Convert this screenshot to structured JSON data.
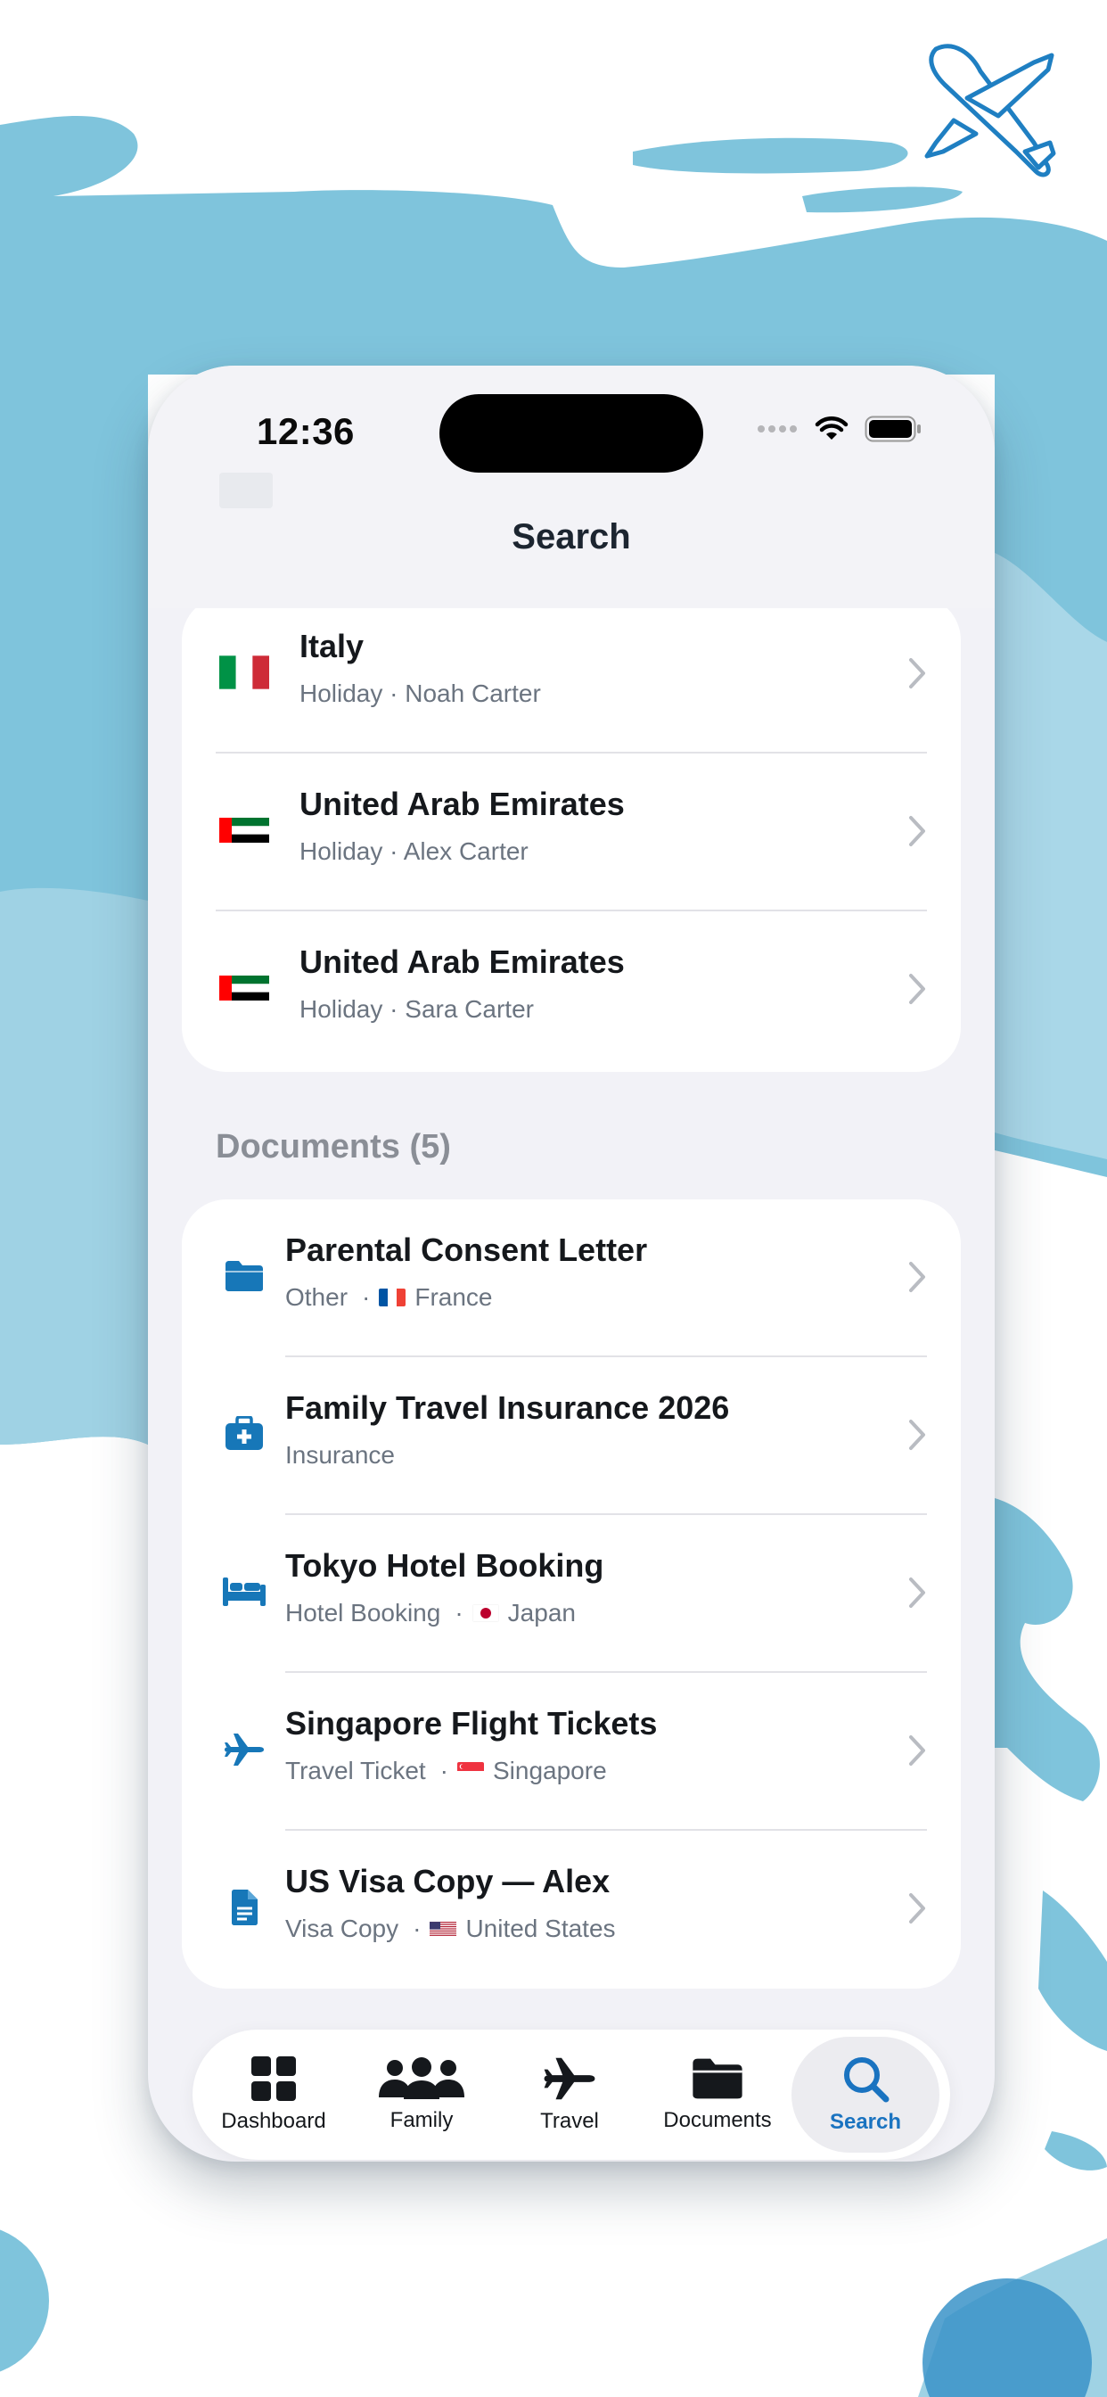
{
  "status_bar": {
    "time": "12:36"
  },
  "nav": {
    "title": "Search"
  },
  "trips": [
    {
      "title": "Italy",
      "subtitle": "Holiday · Noah Carter",
      "flag": "it"
    },
    {
      "title": "United Arab Emirates",
      "subtitle": "Holiday · Alex Carter",
      "flag": "ae"
    },
    {
      "title": "United Arab Emirates",
      "subtitle": "Holiday · Sara Carter",
      "flag": "ae"
    }
  ],
  "documents_section": {
    "header": "Documents (5)"
  },
  "documents": [
    {
      "title": "Parental Consent Letter",
      "type": "Other",
      "country": "France",
      "icon": "folder-icon",
      "flag": "fr"
    },
    {
      "title": "Family Travel Insurance 2026",
      "type": "Insurance",
      "country": "",
      "icon": "medical-case-icon",
      "flag": ""
    },
    {
      "title": "Tokyo Hotel Booking",
      "type": "Hotel Booking",
      "country": "Japan",
      "icon": "bed-icon",
      "flag": "jp"
    },
    {
      "title": "Singapore Flight Tickets",
      "type": "Travel Ticket",
      "country": "Singapore",
      "icon": "airplane-icon",
      "flag": "sg"
    },
    {
      "title": "US Visa Copy — Alex",
      "type": "Visa Copy",
      "country": "United States",
      "icon": "document-icon",
      "flag": "us"
    }
  ],
  "separator": "·",
  "tabs": [
    {
      "label": "Dashboard",
      "icon": "grid-icon",
      "active": false
    },
    {
      "label": "Family",
      "icon": "people-icon",
      "active": false
    },
    {
      "label": "Travel",
      "icon": "airplane-icon",
      "active": false
    },
    {
      "label": "Documents",
      "icon": "folder-icon",
      "active": false
    },
    {
      "label": "Search",
      "icon": "magnifier-icon",
      "active": true
    }
  ],
  "colors": {
    "accent": "#1a73c0",
    "background_sea": "#7fc4dc",
    "icon_blue": "#1777b8"
  }
}
